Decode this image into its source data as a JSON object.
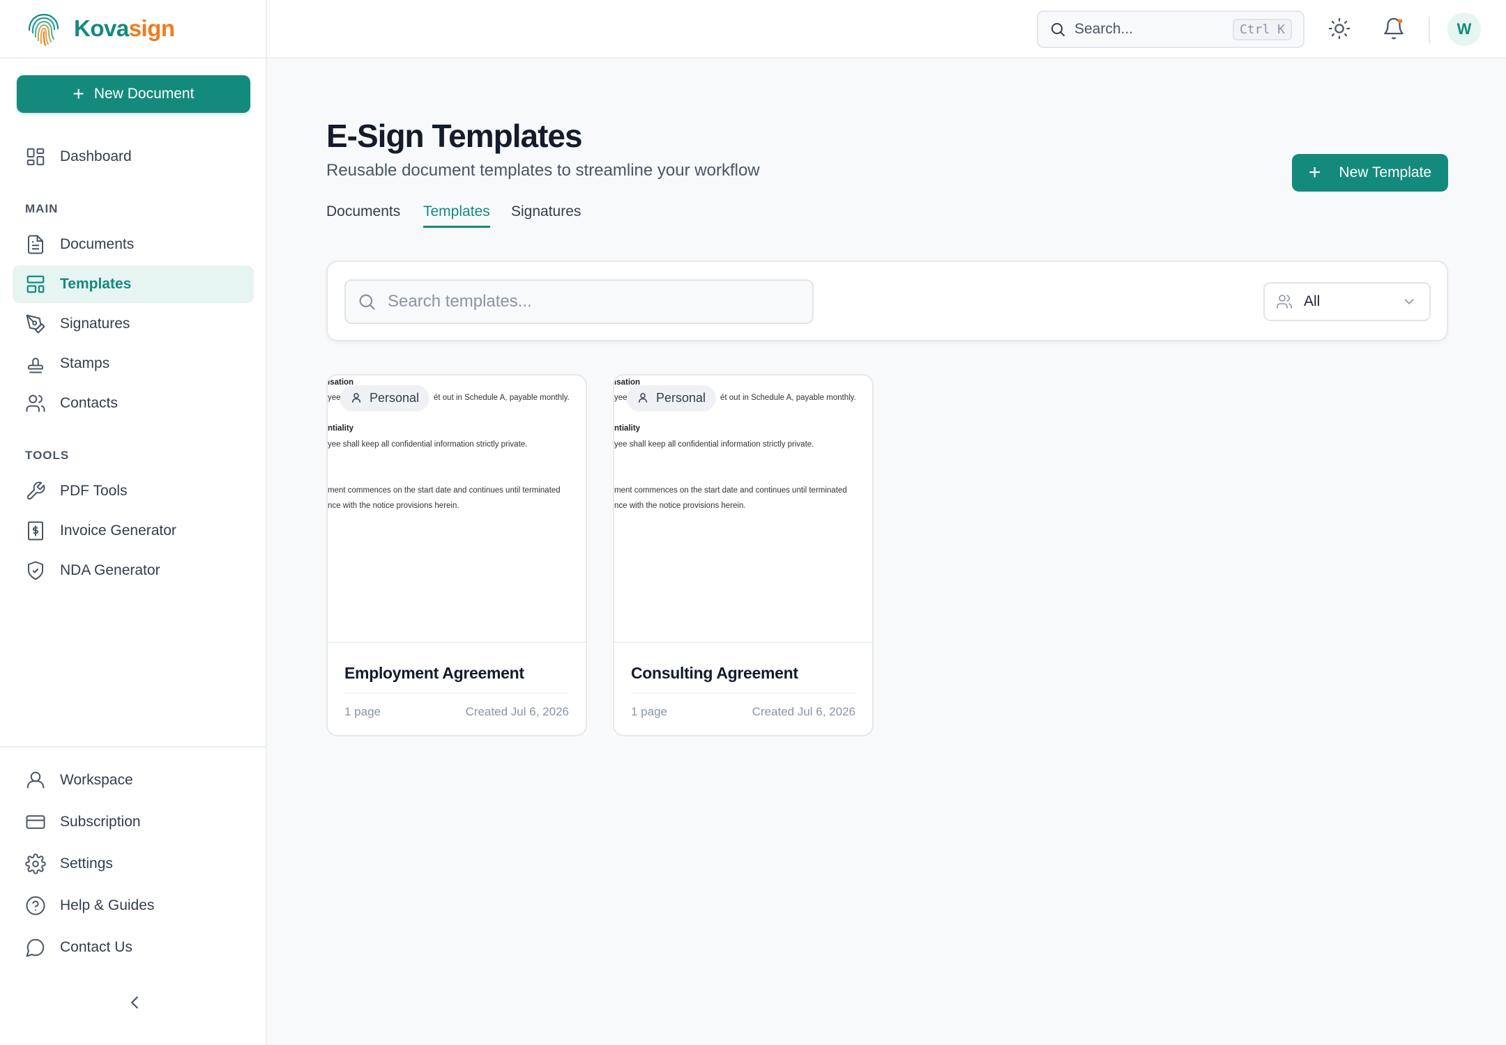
{
  "app": {
    "logo_part1": "Kova",
    "logo_part2": "sign",
    "brand_color": "#148a7d",
    "accent_color": "#f07b1f"
  },
  "sidebar": {
    "new_document_label": "New Document",
    "dashboard_label": "Dashboard",
    "main_section_label": "MAIN",
    "main_items": [
      {
        "label": "Documents",
        "icon": "file-text-icon"
      },
      {
        "label": "Templates",
        "icon": "layout-template-icon",
        "active": true
      },
      {
        "label": "Signatures",
        "icon": "pen-tool-icon"
      },
      {
        "label": "Stamps",
        "icon": "stamp-icon"
      },
      {
        "label": "Contacts",
        "icon": "users-icon"
      }
    ],
    "tools_section_label": "TOOLS",
    "tool_items": [
      {
        "label": "PDF Tools",
        "icon": "wrench-icon"
      },
      {
        "label": "Invoice Generator",
        "icon": "receipt-icon"
      },
      {
        "label": "NDA Generator",
        "icon": "shield-check-icon"
      }
    ],
    "bottom_items": [
      {
        "label": "Workspace",
        "icon": "user-icon"
      },
      {
        "label": "Subscription",
        "icon": "credit-card-icon"
      },
      {
        "label": "Settings",
        "icon": "gear-icon"
      },
      {
        "label": "Help & Guides",
        "icon": "help-circle-icon"
      },
      {
        "label": "Contact Us",
        "icon": "message-circle-icon"
      }
    ]
  },
  "topbar": {
    "search_placeholder": "Search...",
    "shortcut": "Ctrl K",
    "avatar_initial": "W"
  },
  "page": {
    "title": "E-Sign Templates",
    "subtitle": "Reusable document templates to streamline your workflow",
    "new_template_label": "New Template",
    "tabs": [
      {
        "label": "Documents",
        "active": false
      },
      {
        "label": "Templates",
        "active": true
      },
      {
        "label": "Signatures",
        "active": false
      }
    ],
    "search_placeholder": "Search templates...",
    "scope_filter_value": "All"
  },
  "templates": [
    {
      "name": "Employment Agreement",
      "badge": "Personal",
      "pages": "1 page",
      "created": "Created Jul 6, 2026",
      "preview_lines": [
        "ısation",
        "yee",
        "ét out in Schedule A, payable monthly.",
        "ntiality",
        "yee shall keep all confidential information strictly private.",
        "ment commences on the start date and continues until terminated",
        "nce with the notice provisions herein."
      ]
    },
    {
      "name": "Consulting Agreement",
      "badge": "Personal",
      "pages": "1 page",
      "created": "Created Jul 6, 2026",
      "preview_lines": [
        "ısation",
        "yee",
        "ét out in Schedule A, payable monthly.",
        "ntiality",
        "yee shall keep all confidential information strictly private.",
        "ment commences on the start date and continues until terminated",
        "nce with the notice provisions herein."
      ]
    }
  ]
}
